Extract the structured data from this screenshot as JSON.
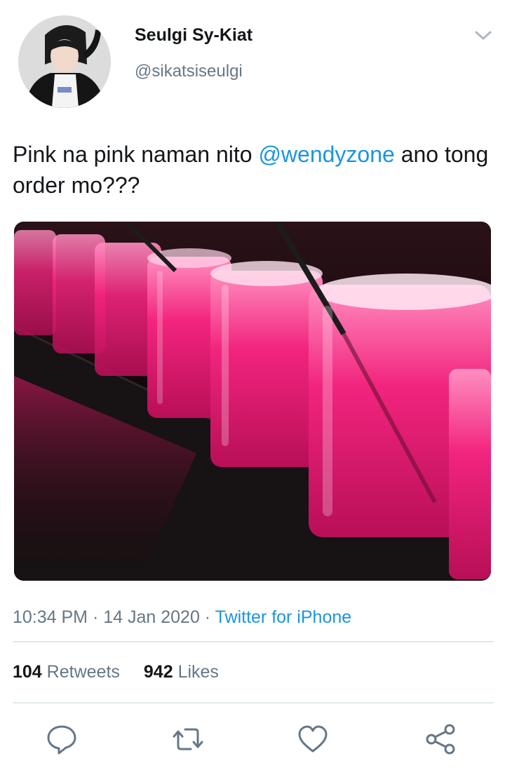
{
  "user": {
    "display_name": "Seulgi Sy-Kiat",
    "handle": "@sikatsiseulgi"
  },
  "tweet": {
    "text_before": "Pink na pink naman nito ",
    "mention": "@wendyzone",
    "text_after": " ano tong order mo???",
    "media_icon": "photo-pink-drinks-in-glasses"
  },
  "meta": {
    "time": "10:34 PM",
    "separator1": " · ",
    "date": "14 Jan 2020",
    "separator2": " · ",
    "source": "Twitter for iPhone"
  },
  "stats": {
    "retweets_count": "104",
    "retweets_label": "Retweets",
    "likes_count": "942",
    "likes_label": "Likes"
  },
  "actions": {
    "reply_icon": "reply-icon",
    "retweet_icon": "retweet-icon",
    "like_icon": "heart-icon",
    "share_icon": "share-icon"
  },
  "colors": {
    "link": "#1b95e0",
    "secondary_text": "#657786",
    "primary_text": "#14171a",
    "divider": "#e1e8ed",
    "drink_pink": "#f0217a"
  }
}
